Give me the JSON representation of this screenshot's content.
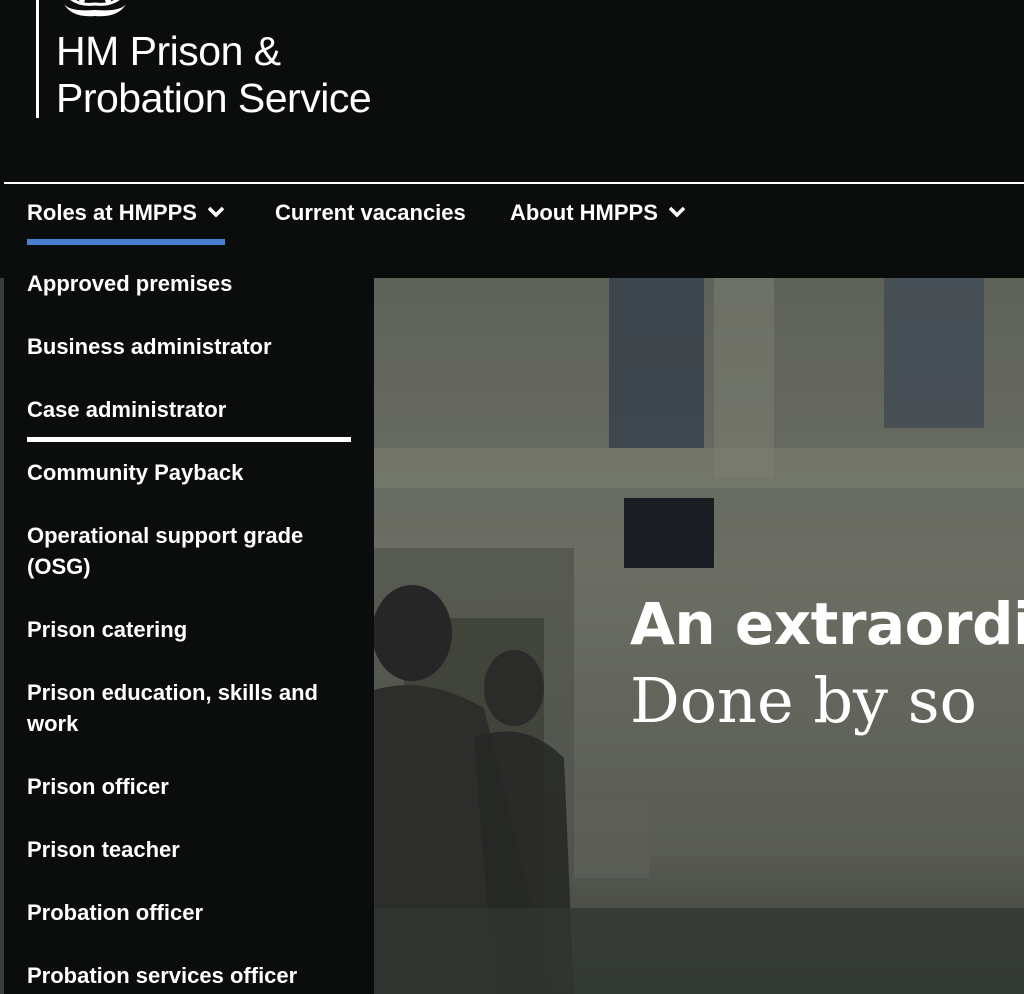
{
  "header": {
    "brand_line1": "HM Prison &",
    "brand_line2": "Probation Service"
  },
  "nav": {
    "items": [
      {
        "label": "Roles at HMPPS",
        "has_dropdown": true,
        "active": true
      },
      {
        "label": "Current vacancies",
        "has_dropdown": false,
        "active": false
      },
      {
        "label": "About HMPPS",
        "has_dropdown": true,
        "active": false
      }
    ],
    "active_underline_color": "#4a7fd1"
  },
  "dropdown": {
    "items": [
      "Approved premises",
      "Business administrator",
      "Case administrator",
      "Community Payback",
      "Operational support grade (OSG)",
      "Prison catering",
      "Prison education, skills and work",
      "Prison officer",
      "Prison teacher",
      "Probation officer",
      "Probation services officer"
    ],
    "focused_item": "Case administrator"
  },
  "hero": {
    "headline": "An extraordi",
    "subheadline": "Done by so"
  },
  "colors": {
    "background": "#0b0c0c",
    "text": "#ffffff",
    "accent": "#4a7fd1"
  },
  "icons": {
    "crest": "royal-crest-icon",
    "chevron": "chevron-down-icon"
  }
}
